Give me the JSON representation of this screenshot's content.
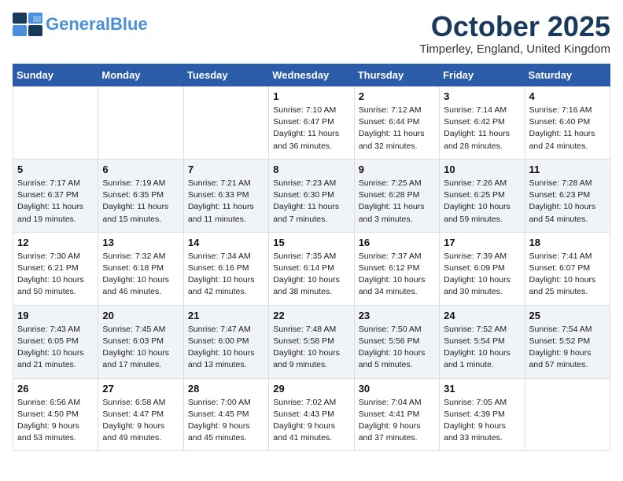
{
  "header": {
    "logo_general": "General",
    "logo_blue": "Blue",
    "month_title": "October 2025",
    "location": "Timperley, England, United Kingdom"
  },
  "days_of_week": [
    "Sunday",
    "Monday",
    "Tuesday",
    "Wednesday",
    "Thursday",
    "Friday",
    "Saturday"
  ],
  "weeks": [
    [
      {
        "day": "",
        "info": ""
      },
      {
        "day": "",
        "info": ""
      },
      {
        "day": "",
        "info": ""
      },
      {
        "day": "1",
        "info": "Sunrise: 7:10 AM\nSunset: 6:47 PM\nDaylight: 11 hours\nand 36 minutes."
      },
      {
        "day": "2",
        "info": "Sunrise: 7:12 AM\nSunset: 6:44 PM\nDaylight: 11 hours\nand 32 minutes."
      },
      {
        "day": "3",
        "info": "Sunrise: 7:14 AM\nSunset: 6:42 PM\nDaylight: 11 hours\nand 28 minutes."
      },
      {
        "day": "4",
        "info": "Sunrise: 7:16 AM\nSunset: 6:40 PM\nDaylight: 11 hours\nand 24 minutes."
      }
    ],
    [
      {
        "day": "5",
        "info": "Sunrise: 7:17 AM\nSunset: 6:37 PM\nDaylight: 11 hours\nand 19 minutes."
      },
      {
        "day": "6",
        "info": "Sunrise: 7:19 AM\nSunset: 6:35 PM\nDaylight: 11 hours\nand 15 minutes."
      },
      {
        "day": "7",
        "info": "Sunrise: 7:21 AM\nSunset: 6:33 PM\nDaylight: 11 hours\nand 11 minutes."
      },
      {
        "day": "8",
        "info": "Sunrise: 7:23 AM\nSunset: 6:30 PM\nDaylight: 11 hours\nand 7 minutes."
      },
      {
        "day": "9",
        "info": "Sunrise: 7:25 AM\nSunset: 6:28 PM\nDaylight: 11 hours\nand 3 minutes."
      },
      {
        "day": "10",
        "info": "Sunrise: 7:26 AM\nSunset: 6:25 PM\nDaylight: 10 hours\nand 59 minutes."
      },
      {
        "day": "11",
        "info": "Sunrise: 7:28 AM\nSunset: 6:23 PM\nDaylight: 10 hours\nand 54 minutes."
      }
    ],
    [
      {
        "day": "12",
        "info": "Sunrise: 7:30 AM\nSunset: 6:21 PM\nDaylight: 10 hours\nand 50 minutes."
      },
      {
        "day": "13",
        "info": "Sunrise: 7:32 AM\nSunset: 6:18 PM\nDaylight: 10 hours\nand 46 minutes."
      },
      {
        "day": "14",
        "info": "Sunrise: 7:34 AM\nSunset: 6:16 PM\nDaylight: 10 hours\nand 42 minutes."
      },
      {
        "day": "15",
        "info": "Sunrise: 7:35 AM\nSunset: 6:14 PM\nDaylight: 10 hours\nand 38 minutes."
      },
      {
        "day": "16",
        "info": "Sunrise: 7:37 AM\nSunset: 6:12 PM\nDaylight: 10 hours\nand 34 minutes."
      },
      {
        "day": "17",
        "info": "Sunrise: 7:39 AM\nSunset: 6:09 PM\nDaylight: 10 hours\nand 30 minutes."
      },
      {
        "day": "18",
        "info": "Sunrise: 7:41 AM\nSunset: 6:07 PM\nDaylight: 10 hours\nand 25 minutes."
      }
    ],
    [
      {
        "day": "19",
        "info": "Sunrise: 7:43 AM\nSunset: 6:05 PM\nDaylight: 10 hours\nand 21 minutes."
      },
      {
        "day": "20",
        "info": "Sunrise: 7:45 AM\nSunset: 6:03 PM\nDaylight: 10 hours\nand 17 minutes."
      },
      {
        "day": "21",
        "info": "Sunrise: 7:47 AM\nSunset: 6:00 PM\nDaylight: 10 hours\nand 13 minutes."
      },
      {
        "day": "22",
        "info": "Sunrise: 7:48 AM\nSunset: 5:58 PM\nDaylight: 10 hours\nand 9 minutes."
      },
      {
        "day": "23",
        "info": "Sunrise: 7:50 AM\nSunset: 5:56 PM\nDaylight: 10 hours\nand 5 minutes."
      },
      {
        "day": "24",
        "info": "Sunrise: 7:52 AM\nSunset: 5:54 PM\nDaylight: 10 hours\nand 1 minute."
      },
      {
        "day": "25",
        "info": "Sunrise: 7:54 AM\nSunset: 5:52 PM\nDaylight: 9 hours\nand 57 minutes."
      }
    ],
    [
      {
        "day": "26",
        "info": "Sunrise: 6:56 AM\nSunset: 4:50 PM\nDaylight: 9 hours\nand 53 minutes."
      },
      {
        "day": "27",
        "info": "Sunrise: 6:58 AM\nSunset: 4:47 PM\nDaylight: 9 hours\nand 49 minutes."
      },
      {
        "day": "28",
        "info": "Sunrise: 7:00 AM\nSunset: 4:45 PM\nDaylight: 9 hours\nand 45 minutes."
      },
      {
        "day": "29",
        "info": "Sunrise: 7:02 AM\nSunset: 4:43 PM\nDaylight: 9 hours\nand 41 minutes."
      },
      {
        "day": "30",
        "info": "Sunrise: 7:04 AM\nSunset: 4:41 PM\nDaylight: 9 hours\nand 37 minutes."
      },
      {
        "day": "31",
        "info": "Sunrise: 7:05 AM\nSunset: 4:39 PM\nDaylight: 9 hours\nand 33 minutes."
      },
      {
        "day": "",
        "info": ""
      }
    ]
  ]
}
